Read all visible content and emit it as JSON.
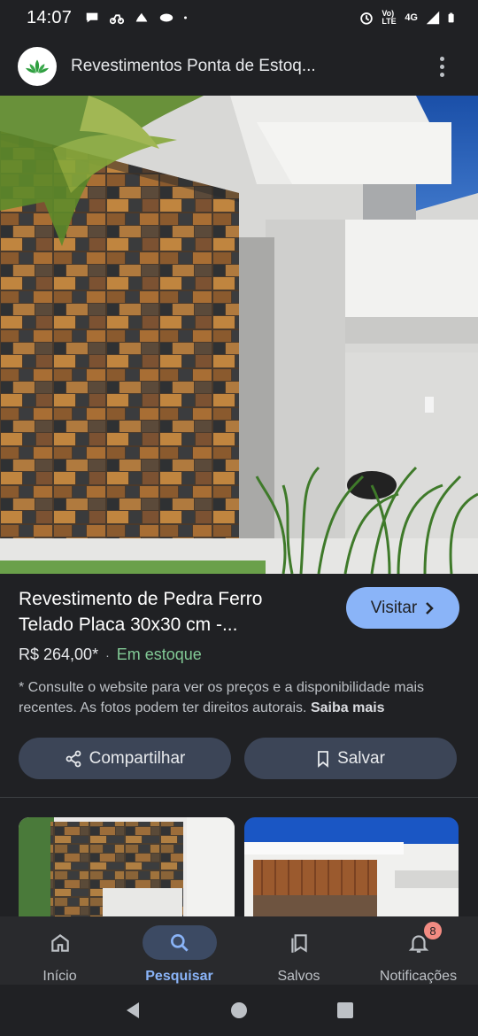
{
  "status_bar": {
    "time": "14:07",
    "network": "4G",
    "volte": "Vo) LTE",
    "icons_left": [
      "chat-bubble-icon",
      "bike-icon",
      "recycle-icon",
      "bowl-icon",
      "dot-icon"
    ],
    "icons_right": [
      "alarm-icon",
      "volte-icon",
      "signal-icon",
      "battery-icon"
    ]
  },
  "header": {
    "site_title": "Revestimentos Ponta de Estoq...",
    "logo_icon": "lotus-logo-icon",
    "menu_icon": "more-vert-icon"
  },
  "product": {
    "title": "Revestimento de Pedra Ferro Telado Placa 30x30 cm -...",
    "price": "R$ 264,00*",
    "separator": "·",
    "stock": "Em estoque",
    "disclaimer": "* Consulte o website para ver os preços e a disponibilidade mais recentes. As fotos podem ter direitos autorais.",
    "learn_more": "Saiba mais",
    "visit_label": "Visitar"
  },
  "actions": {
    "share_label": "Compartilhar",
    "save_label": "Salvar"
  },
  "bottom_nav": {
    "items": [
      {
        "label": "Início",
        "icon": "home-icon"
      },
      {
        "label": "Pesquisar",
        "icon": "search-icon",
        "active": true
      },
      {
        "label": "Salvos",
        "icon": "bookmarks-icon"
      },
      {
        "label": "Notificações",
        "icon": "bell-icon",
        "badge": "8"
      }
    ]
  },
  "colors": {
    "background": "#202124",
    "accent": "#8ab4f8",
    "stock_green": "#81c995",
    "badge": "#f28b82"
  }
}
